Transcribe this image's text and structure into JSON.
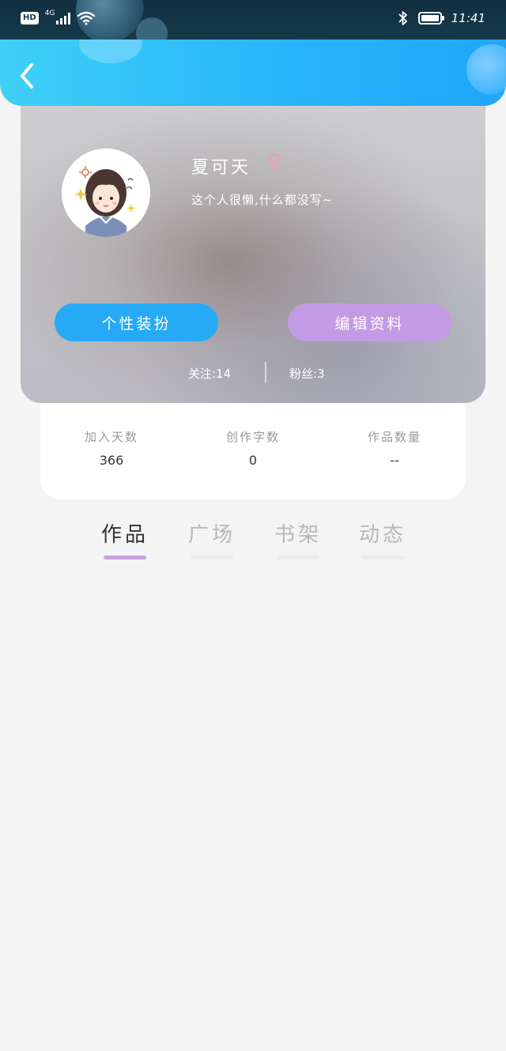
{
  "status_bar": {
    "hd": "HD",
    "network": "4G",
    "time": "11:41"
  },
  "profile": {
    "name": "夏可天",
    "gender_symbol": "♀",
    "bio": "这个人很懒,什么都没写~",
    "costume_button": "个性装扮",
    "edit_button": "编辑资料",
    "following": "关注:14",
    "fans": "粉丝:3"
  },
  "stats": {
    "days_label": "加入天数",
    "days_value": "366",
    "words_label": "创作字数",
    "words_value": "0",
    "works_label": "作品数量",
    "works_value": "--"
  },
  "tabs": {
    "works": "作品",
    "square": "广场",
    "shelf": "书架",
    "activity": "动态"
  },
  "colors": {
    "header_start": "#3fd0f7",
    "header_end": "#1fa6fb",
    "costume_button": "#27aaf6",
    "edit_button": "#c39ae4",
    "tab_indicator": "#c8a2dd",
    "gender": "#f29bb4"
  },
  "icons": {
    "back": "chevron-left-icon",
    "gender": "female-icon",
    "wifi": "wifi-icon",
    "bluetooth": "bluetooth-icon",
    "battery": "battery-icon"
  }
}
